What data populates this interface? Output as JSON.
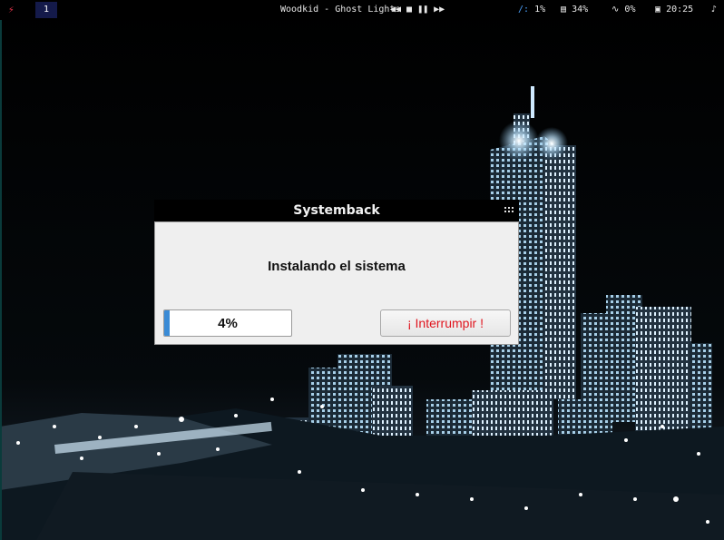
{
  "topbar": {
    "workspace": "1",
    "now_playing": "Woodkid - Ghost Lights",
    "media_icons": [
      "rewind-icon",
      "stop-icon",
      "pause-icon",
      "fast-forward-icon"
    ],
    "cpu": {
      "icon": "/:",
      "value": "1%"
    },
    "memory": {
      "icon": "memory-icon",
      "value": "34%"
    },
    "network": {
      "icon": "activity-icon",
      "value": "0%"
    },
    "clock": {
      "icon": "calendar-icon",
      "value": "20:25"
    }
  },
  "window": {
    "title": "Systemback",
    "message": "Instalando el sistema",
    "progress": {
      "value": 4,
      "label": "4%"
    },
    "abort_label": "¡ Interrumpir !",
    "accent_color": "#3a8bd6",
    "abort_color": "#e0141e"
  }
}
